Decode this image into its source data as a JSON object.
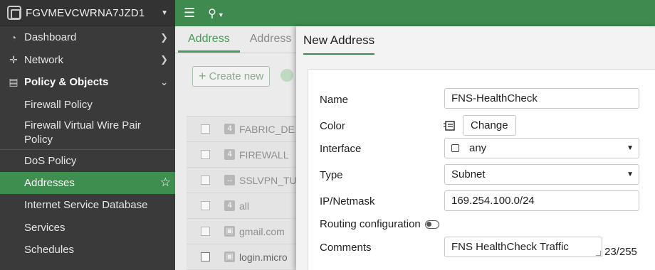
{
  "sidebar": {
    "device_name": "FGVMEVCWRNA7JZD1",
    "items": [
      {
        "label": "Dashboard",
        "icon": "gauge-icon",
        "type": "group-collapsed"
      },
      {
        "label": "Network",
        "icon": "network-icon",
        "type": "group-collapsed"
      },
      {
        "label": "Policy & Objects",
        "icon": "document-icon",
        "type": "group-expanded"
      }
    ],
    "subitems": [
      {
        "label": "Firewall Policy"
      },
      {
        "label": "Firewall Virtual Wire Pair Policy"
      },
      {
        "label": "DoS Policy"
      },
      {
        "label": "Addresses",
        "active": true
      },
      {
        "label": "Internet Service Database"
      },
      {
        "label": "Services"
      },
      {
        "label": "Schedules"
      }
    ]
  },
  "topbar": {
    "menu_icon": "hamburger-icon",
    "search_icon": "search-icon"
  },
  "background": {
    "tabs": [
      "Address",
      "Address"
    ],
    "create_label": "Create new",
    "rows": [
      "FABRIC_DE",
      "FIREWALL",
      "SSLVPN_TU",
      "all",
      "gmail.com",
      "login.micro"
    ]
  },
  "pane": {
    "title": "New Address",
    "fields": {
      "name_label": "Name",
      "name_value": "FNS-HealthCheck",
      "color_label": "Color",
      "change_label": "Change",
      "interface_label": "Interface",
      "interface_value": "any",
      "type_label": "Type",
      "type_value": "Subnet",
      "ip_label": "IP/Netmask",
      "ip_value": "169.254.100.0/24",
      "routing_label": "Routing configuration",
      "comments_label": "Comments",
      "comments_value": "FNS HealthCheck Traffic",
      "comments_counter": "23/255"
    }
  },
  "colors": {
    "brand_green": "#3f8a4e",
    "sidebar_bg": "#3a3a3a"
  }
}
